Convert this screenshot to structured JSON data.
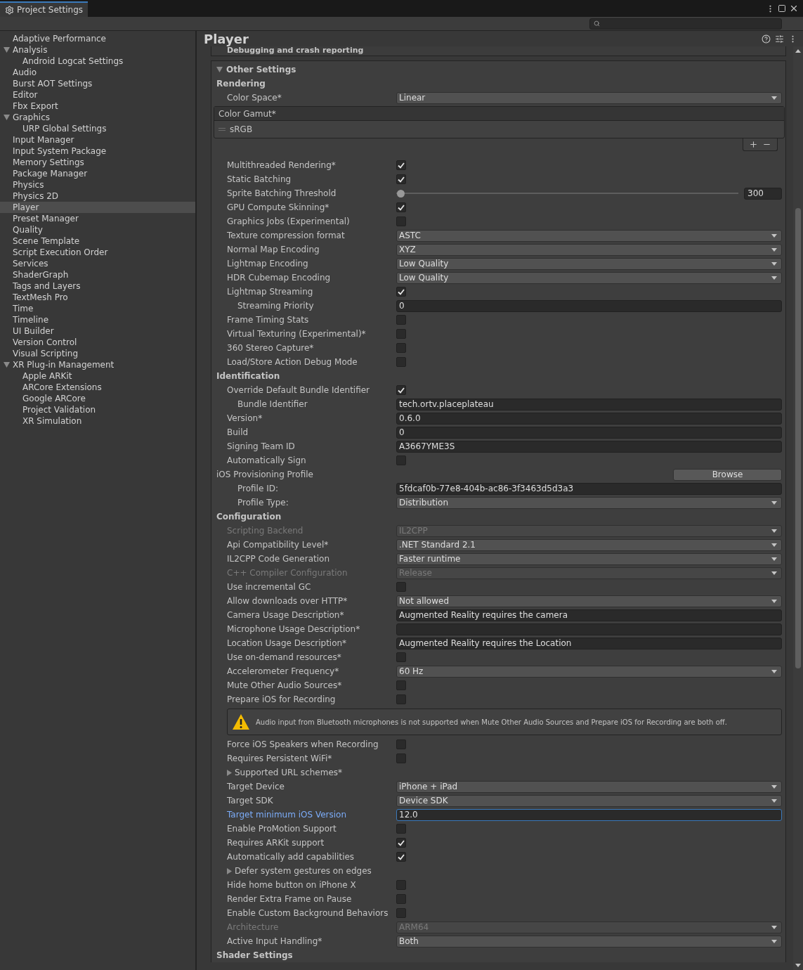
{
  "window": {
    "tab": "Project Settings"
  },
  "sidebar": {
    "items": [
      {
        "label": "Adaptive Performance",
        "selected": false
      },
      {
        "label": "Analysis",
        "selected": false,
        "expanded": true,
        "children": [
          {
            "label": "Android Logcat Settings",
            "selected": false
          }
        ]
      },
      {
        "label": "Audio",
        "selected": false
      },
      {
        "label": "Burst AOT Settings",
        "selected": false
      },
      {
        "label": "Editor",
        "selected": false
      },
      {
        "label": "Fbx Export",
        "selected": false
      },
      {
        "label": "Graphics",
        "selected": false,
        "expanded": true,
        "children": [
          {
            "label": "URP Global Settings",
            "selected": false
          }
        ]
      },
      {
        "label": "Input Manager",
        "selected": false
      },
      {
        "label": "Input System Package",
        "selected": false
      },
      {
        "label": "Memory Settings",
        "selected": false
      },
      {
        "label": "Package Manager",
        "selected": false
      },
      {
        "label": "Physics",
        "selected": false
      },
      {
        "label": "Physics 2D",
        "selected": false
      },
      {
        "label": "Player",
        "selected": true
      },
      {
        "label": "Preset Manager",
        "selected": false
      },
      {
        "label": "Quality",
        "selected": false
      },
      {
        "label": "Scene Template",
        "selected": false
      },
      {
        "label": "Script Execution Order",
        "selected": false
      },
      {
        "label": "Services",
        "selected": false
      },
      {
        "label": "ShaderGraph",
        "selected": false
      },
      {
        "label": "Tags and Layers",
        "selected": false
      },
      {
        "label": "TextMesh Pro",
        "selected": false
      },
      {
        "label": "Time",
        "selected": false
      },
      {
        "label": "Timeline",
        "selected": false
      },
      {
        "label": "UI Builder",
        "selected": false
      },
      {
        "label": "Version Control",
        "selected": false
      },
      {
        "label": "Visual Scripting",
        "selected": false
      },
      {
        "label": "XR Plug-in Management",
        "selected": false,
        "expanded": true,
        "children": [
          {
            "label": "Apple ARKit",
            "selected": false
          },
          {
            "label": "ARCore Extensions",
            "selected": false
          },
          {
            "label": "Google ARCore",
            "selected": false
          },
          {
            "label": "Project Validation",
            "selected": false
          },
          {
            "label": "XR Simulation",
            "selected": false
          }
        ]
      }
    ]
  },
  "inspector": {
    "title": "Player",
    "collapsed_section": "Debugging and crash reporting",
    "section": {
      "title": "Other Settings",
      "expanded": true,
      "groups": [
        {
          "title": "Rendering",
          "rows": [
            {
              "kind": "dropdown",
              "label": "Color Space*",
              "value": "Linear",
              "disabled": false
            },
            {
              "kind": "list",
              "label": "Color Gamut*",
              "items": [
                "sRGB"
              ]
            },
            {
              "kind": "checkbox",
              "label": "Multithreaded Rendering*",
              "checked": true
            },
            {
              "kind": "checkbox",
              "label": "Static Batching",
              "checked": true
            },
            {
              "kind": "slider",
              "label": "Sprite Batching Threshold",
              "level": 0,
              "value": "300"
            },
            {
              "kind": "checkbox",
              "label": "GPU Compute Skinning*",
              "checked": true
            },
            {
              "kind": "checkbox",
              "label": "Graphics Jobs (Experimental)",
              "checked": false
            },
            {
              "kind": "dropdown",
              "label": "Texture compression format",
              "value": "ASTC",
              "disabled": false
            },
            {
              "kind": "dropdown",
              "label": "Normal Map Encoding",
              "value": "XYZ",
              "disabled": false
            },
            {
              "kind": "dropdown",
              "label": "Lightmap Encoding",
              "value": "Low Quality",
              "disabled": false
            },
            {
              "kind": "dropdown",
              "label": "HDR Cubemap Encoding",
              "value": "Low Quality",
              "disabled": false
            },
            {
              "kind": "checkbox",
              "label": "Lightmap Streaming",
              "checked": true,
              "children": [
                {
                  "kind": "field",
                  "label": "Streaming Priority",
                  "value": "0",
                  "focused": false
                }
              ]
            },
            {
              "kind": "checkbox",
              "label": "Frame Timing Stats",
              "checked": false
            },
            {
              "kind": "checkbox",
              "label": "Virtual Texturing (Experimental)*",
              "checked": false
            },
            {
              "kind": "checkbox",
              "label": "360 Stereo Capture*",
              "checked": false
            },
            {
              "kind": "checkbox",
              "label": "Load/Store Action Debug Mode",
              "checked": false
            }
          ]
        },
        {
          "title": "Identification",
          "rows": [
            {
              "kind": "checkbox",
              "label": "Override Default Bundle Identifier",
              "checked": true,
              "children": [
                {
                  "kind": "field",
                  "label": "Bundle Identifier",
                  "value": "tech.ortv.placeplateau",
                  "focused": false
                }
              ]
            },
            {
              "kind": "field",
              "label": "Version*",
              "value": "0.6.0",
              "focused": false
            },
            {
              "kind": "field",
              "label": "Build",
              "value": "0",
              "focused": false
            },
            {
              "kind": "field",
              "label": "Signing Team ID",
              "value": "A3667YME3S",
              "focused": false
            },
            {
              "kind": "checkbox",
              "label": "Automatically Sign",
              "checked": false
            },
            {
              "kind": "browse",
              "label": "iOS Provisioning Profile",
              "button": "Browse",
              "children": [
                {
                  "kind": "field",
                  "label": "Profile ID:",
                  "value": "5fdcaf0b-77e8-404b-ac86-3f3463d5d3a3",
                  "focused": false
                },
                {
                  "kind": "dropdown",
                  "label": "Profile Type:",
                  "value": "Distribution",
                  "disabled": false
                }
              ]
            }
          ]
        },
        {
          "title": "Configuration",
          "rows": [
            {
              "kind": "dropdown",
              "label": "Scripting Backend",
              "value": "IL2CPP",
              "disabled": true
            },
            {
              "kind": "dropdown",
              "label": "Api Compatibility Level*",
              "value": ".NET Standard 2.1",
              "disabled": false
            },
            {
              "kind": "dropdown",
              "label": "IL2CPP Code Generation",
              "value": "Faster runtime",
              "disabled": false
            },
            {
              "kind": "dropdown",
              "label": "C++ Compiler Configuration",
              "value": "Release",
              "disabled": true
            },
            {
              "kind": "checkbox",
              "label": "Use incremental GC",
              "checked": false
            },
            {
              "kind": "dropdown",
              "label": "Allow downloads over HTTP*",
              "value": "Not allowed",
              "disabled": false
            },
            {
              "kind": "field",
              "label": "Camera Usage Description*",
              "value": "Augmented Reality requires the camera",
              "focused": false
            },
            {
              "kind": "field",
              "label": "Microphone Usage Description*",
              "focused": false
            },
            {
              "kind": "field",
              "label": "Location Usage Description*",
              "value": "Augmented Reality requires the Location",
              "focused": false
            },
            {
              "kind": "checkbox",
              "label": "Use on-demand resources*",
              "checked": false
            },
            {
              "kind": "dropdown",
              "label": "Accelerometer Frequency*",
              "value": "60 Hz",
              "disabled": false
            },
            {
              "kind": "checkbox",
              "label": "Mute Other Audio Sources*",
              "checked": false
            },
            {
              "kind": "checkbox",
              "label": "Prepare iOS for Recording",
              "checked": false
            },
            {
              "kind": "warning",
              "text": "Audio input from Bluetooth microphones is not supported when Mute Other Audio Sources and Prepare iOS for Recording are both off."
            },
            {
              "kind": "checkbox",
              "label": "Force iOS Speakers when Recording",
              "checked": false
            },
            {
              "kind": "checkbox",
              "label": "Requires Persistent WiFi*",
              "checked": false
            },
            {
              "kind": "foldout",
              "label": "Supported URL schemes*",
              "expanded": false
            },
            {
              "kind": "dropdown",
              "label": "Target Device",
              "value": "iPhone + iPad",
              "disabled": false
            },
            {
              "kind": "dropdown",
              "label": "Target SDK",
              "value": "Device SDK",
              "disabled": false
            },
            {
              "kind": "field",
              "label": "Target minimum iOS Version",
              "value": "12.0",
              "focused": true
            },
            {
              "kind": "checkbox",
              "label": "Enable ProMotion Support",
              "checked": false
            },
            {
              "kind": "checkbox",
              "label": "Requires ARKit support",
              "checked": true
            },
            {
              "kind": "checkbox",
              "label": "Automatically add capabilities",
              "checked": true
            },
            {
              "kind": "foldout",
              "label": "Defer system gestures on edges",
              "expanded": false
            },
            {
              "kind": "checkbox",
              "label": "Hide home button on iPhone X",
              "checked": false
            },
            {
              "kind": "checkbox",
              "label": "Render Extra Frame on Pause",
              "checked": false
            },
            {
              "kind": "checkbox",
              "label": "Enable Custom Background Behaviors",
              "checked": false
            },
            {
              "kind": "dropdown",
              "label": "Architecture",
              "value": "ARM64",
              "disabled": true
            },
            {
              "kind": "dropdown",
              "label": "Active Input Handling*",
              "value": "Both",
              "disabled": false
            }
          ]
        },
        {
          "title": "Shader Settings"
        }
      ]
    }
  }
}
